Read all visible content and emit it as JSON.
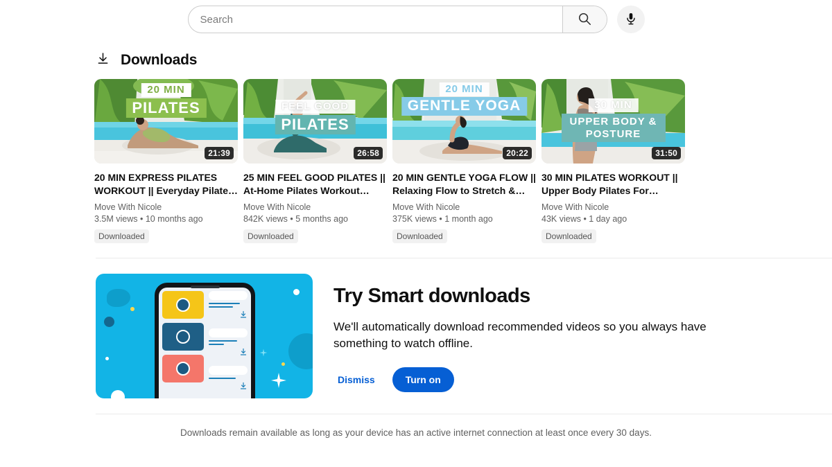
{
  "search": {
    "placeholder": "Search",
    "value": "",
    "search_icon": "search-icon",
    "mic_icon": "microphone-icon"
  },
  "section": {
    "icon": "download-icon",
    "title": "Downloads"
  },
  "videos": [
    {
      "overlay_top": "20 MIN",
      "overlay_main": "PILATES",
      "duration": "21:39",
      "title": "20 MIN EXPRESS PILATES WORKOUT || Everyday Pilate…",
      "channel": "Move With Nicole",
      "meta": "3.5M views • 10 months ago",
      "badge": "Downloaded",
      "accent": "#8cbf4e",
      "top_text_color": "#7fae45",
      "top_bg": "#ffffff"
    },
    {
      "overlay_top": "FEEL GOOD",
      "overlay_main": "PILATES",
      "duration": "26:58",
      "title": "25 MIN FEEL GOOD PILATES || At-Home Pilates Workout…",
      "channel": "Move With Nicole",
      "meta": "842K views • 5 months ago",
      "badge": "Downloaded",
      "accent": "#63b5b0",
      "top_text_color": "#ffffff",
      "top_bg": "#ffffff"
    },
    {
      "overlay_top": "20 MIN",
      "overlay_main": "GENTLE YOGA",
      "duration": "20:22",
      "title": "20 MIN GENTLE YOGA FLOW || Relaxing Flow to Stretch &…",
      "channel": "Move With Nicole",
      "meta": "375K views • 1 month ago",
      "badge": "Downloaded",
      "accent": "#86cbe8",
      "top_text_color": "#86cbe8",
      "top_bg": "#ffffff"
    },
    {
      "overlay_top": "30 MIN",
      "overlay_main": "UPPER BODY & POSTURE",
      "duration": "31:50",
      "title": "30 MIN PILATES WORKOUT || Upper Body Pilates For…",
      "channel": "Move With Nicole",
      "meta": "43K views • 1 day ago",
      "badge": "Downloaded",
      "accent": "#6fb6b4",
      "top_text_color": "#ffffff",
      "top_bg": "#ffffff"
    }
  ],
  "promo": {
    "title": "Try Smart downloads",
    "description": "We'll automatically download recommended videos so you always have something to watch offline.",
    "dismiss_label": "Dismiss",
    "turn_on_label": "Turn on",
    "accent_color": "#065fd4",
    "art_background": "#12b4e6"
  },
  "footnote": "Downloads remain available as long as your device has an active internet connection at least once every 30 days."
}
